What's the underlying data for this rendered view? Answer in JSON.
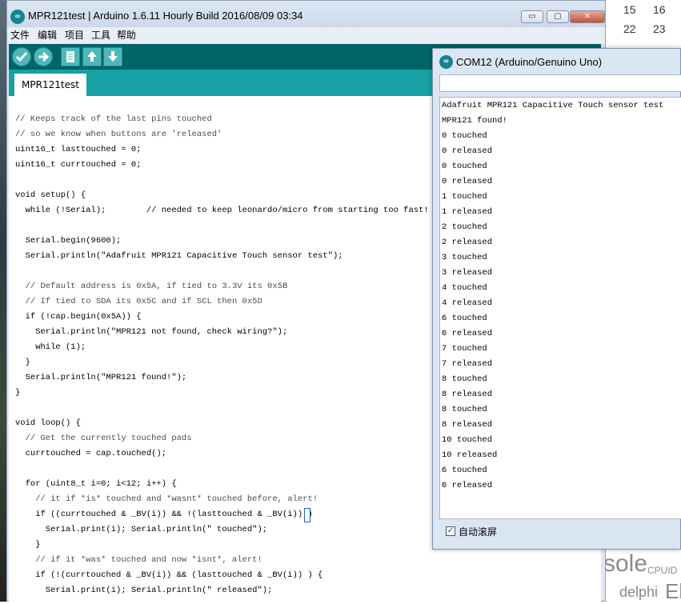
{
  "ide": {
    "title": "MPR121test | Arduino 1.6.11 Hourly Build 2016/08/09 03:34",
    "logo_text": "∞",
    "menu": [
      "文件",
      "编辑",
      "项目",
      "工具",
      "帮助"
    ],
    "tab_label": "MPR121test",
    "window_buttons": {
      "minimize": "▭",
      "restore": "▢",
      "close": "✕"
    },
    "toolbar_icons": [
      "verify-icon",
      "upload-icon",
      "new-icon",
      "open-icon",
      "save-icon"
    ],
    "code_lines": [
      "// Keeps track of the last pins touched",
      "// so we know when buttons are 'released'",
      "uint16_t lasttouched = 0;",
      "uint16_t currtouched = 0;",
      "",
      "void setup() {",
      "  while (!Serial);        // needed to keep leonardo/micro from starting too fast!",
      "",
      "  Serial.begin(9600);",
      "  Serial.println(\"Adafruit MPR121 Capacitive Touch sensor test\");",
      "",
      "  // Default address is 0x5A, if tied to 3.3V its 0x5B",
      "  // If tied to SDA its 0x5C and if SCL then 0x5D",
      "  if (!cap.begin(0x5A)) {",
      "    Serial.println(\"MPR121 not found, check wiring?\");",
      "    while (1);",
      "  }",
      "  Serial.println(\"MPR121 found!\");",
      "}",
      "",
      "void loop() {",
      "  // Get the currently touched pads",
      "  currtouched = cap.touched();",
      "",
      "  for (uint8_t i=0; i<12; i++) {",
      "    // it if *is* touched and *wasnt* touched before, alert!",
      "    if ((currtouched & _BV(i)) && !(lasttouched & _BV(i)) )",
      "      Serial.print(i); Serial.println(\" touched\");",
      "    }",
      "    // if it *was* touched and now *isnt*, alert!",
      "    if (!(currtouched & _BV(i)) && (lasttouched & _BV(i)) ) {",
      "      Serial.print(i); Serial.println(\" released\");"
    ]
  },
  "serial": {
    "title": "COM12 (Arduino/Genuino Uno)",
    "logo_text": "∞",
    "input_value": "",
    "output_lines": [
      "Adafruit MPR121 Capacitive Touch sensor test",
      "MPR121 found!",
      "0 touched",
      "0 released",
      "0 touched",
      "0 released",
      "1 touched",
      "1 released",
      "2 touched",
      "2 released",
      "3 touched",
      "3 released",
      "4 touched",
      "4 released",
      "6 touched",
      "6 released",
      "7 touched",
      "7 released",
      "8 touched",
      "8 released",
      "8 touched",
      "8 released",
      "10 touched",
      "10 released",
      "6 touched",
      "6 released"
    ],
    "autoscroll_label": "自动滚屏",
    "autoscroll_checked": "✓"
  },
  "background": {
    "calendar": [
      "15",
      "16",
      "22",
      "23"
    ],
    "tags": [
      "sole",
      "CPUID",
      "delphi",
      "El"
    ]
  }
}
